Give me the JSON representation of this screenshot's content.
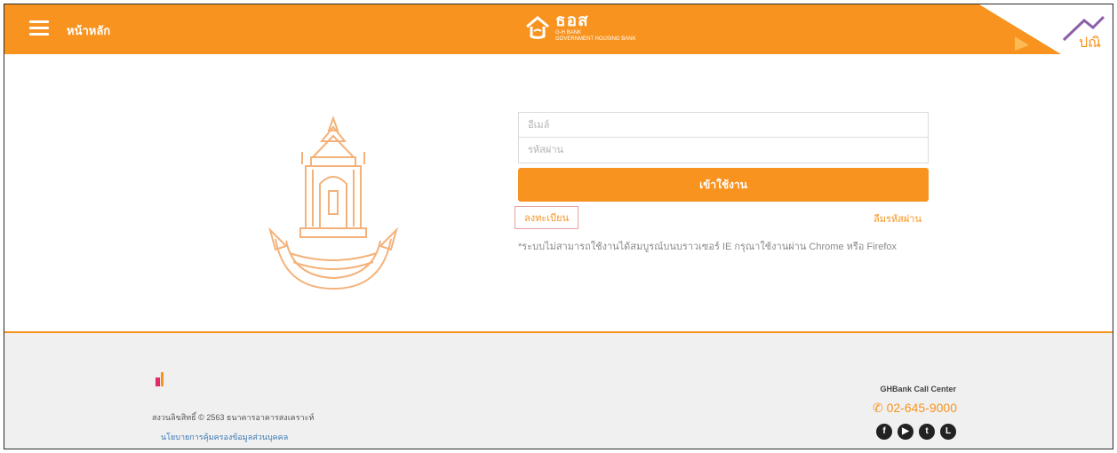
{
  "header": {
    "home_label": "หน้าหลัก",
    "logo_text": "ธอส",
    "logo_sub": "G-H BANK",
    "logo_tagline": "GOVERNMENT HOUSING BANK",
    "corner_badge_text": "ปณิ"
  },
  "login": {
    "username_placeholder": "อีเมล์",
    "password_placeholder": "รหัสผ่าน",
    "submit_label": "เข้าใช้งาน",
    "register_label": "ลงทะเบียน",
    "forgot_label": "ลืมรหัสผ่าน",
    "notice": "*ระบบไม่สามารถใช้งานได้สมบูรณ์บนบราวเซอร์ IE กรุณาใช้งานผ่าน Chrome หรือ Firefox"
  },
  "footer": {
    "copyright": "สงวนลิขสิทธิ์ © 2563 ธนาคารอาคารสงเคราะห์",
    "privacy_link": "นโยบายการคุ้มครองข้อมูลส่วนบุคคล",
    "call_center_label": "GHBank Call Center",
    "phone": "02-645-9000",
    "social_icons": [
      "facebook-icon",
      "youtube-icon",
      "twitter-icon",
      "line-icon"
    ]
  },
  "colors": {
    "brand": "#f7931e",
    "footer_bg": "#f0f0f0"
  }
}
